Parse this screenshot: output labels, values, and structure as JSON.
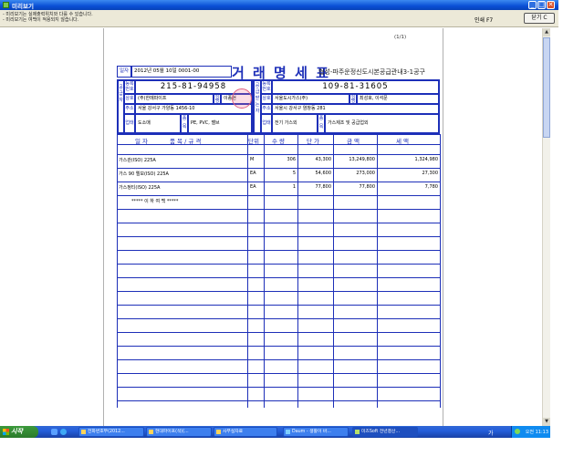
{
  "window": {
    "title": "미리보기",
    "controls": {
      "minimize": "_",
      "maximize": "□",
      "close": "✕"
    }
  },
  "info": {
    "notices": [
      "- 미리보기는 실제출력위치와 다를 수 있습니다.",
      "- 미리보기는 여백이 적용되지 않습니다."
    ],
    "print_label": "인쇄 F7",
    "close_label": "닫기 C"
  },
  "page": {
    "page_number": "(1/1)",
    "date_label": "일자",
    "date_value": "2012년 05월 10일  0001-00",
    "doc_title": "거 래 명 세 표",
    "doc_suffix": "협성-파주운정신도시본공급관내3-1공구",
    "supplier": {
      "side_label": "공 급 자",
      "reg_label": "등록번호",
      "reg_no": "215-81-94958",
      "company_label": "상호",
      "company": "(주)한메파이프",
      "name_label": "성명",
      "name": "이종현",
      "address_label": "주소",
      "address": "서울 강서구 가양동 1456-10",
      "biz_label": "업태",
      "biz": "도소매",
      "type_label": "종목",
      "type": "PE, PVC, 밸브"
    },
    "receiver": {
      "side_label": "공 급 받 는 자",
      "reg_label": "등록번호",
      "reg_no": "109-81-31605",
      "company_label": "상호",
      "company": "서울도시가스(주)",
      "name_label": "성명",
      "name": "최성호, 이석문",
      "address_label": "주소",
      "address": "서울시 강서구 염창동 281",
      "biz_label": "업태",
      "biz": "전기 가스외",
      "type_label": "종목",
      "type": "가스제조 및 공급업외"
    },
    "table": {
      "headers": {
        "date": "일 자",
        "item": "품 목 / 규 격",
        "unit": "단위",
        "qty": "수 량",
        "price": "단 가",
        "amount": "금 액",
        "tax": "세 액"
      },
      "rows": [
        {
          "item": "가스관(ISO) 225A",
          "unit": "M",
          "qty": "306",
          "price": "43,300",
          "amount": "13,249,800",
          "tax": "1,324,980"
        },
        {
          "item": "가스 90 엘보(ISO) 225A",
          "unit": "EA",
          "qty": "5",
          "price": "54,600",
          "amount": "273,000",
          "tax": "27,300"
        },
        {
          "item": "가스정티(ISO) 225A",
          "unit": "EA",
          "qty": "1",
          "price": "77,800",
          "amount": "77,800",
          "tax": "7,780"
        }
      ],
      "end_marker": "***** 이   하   여   백 *****"
    }
  },
  "taskbar": {
    "start_label": "시작",
    "tasks": [
      "전화번호부(2012...",
      "현대파이프(석)(...",
      "사무실자료",
      "Daum - 생활이 바...",
      "미즈Soft 전년결산..."
    ],
    "ime": "가",
    "clock": "오전 11:13"
  }
}
